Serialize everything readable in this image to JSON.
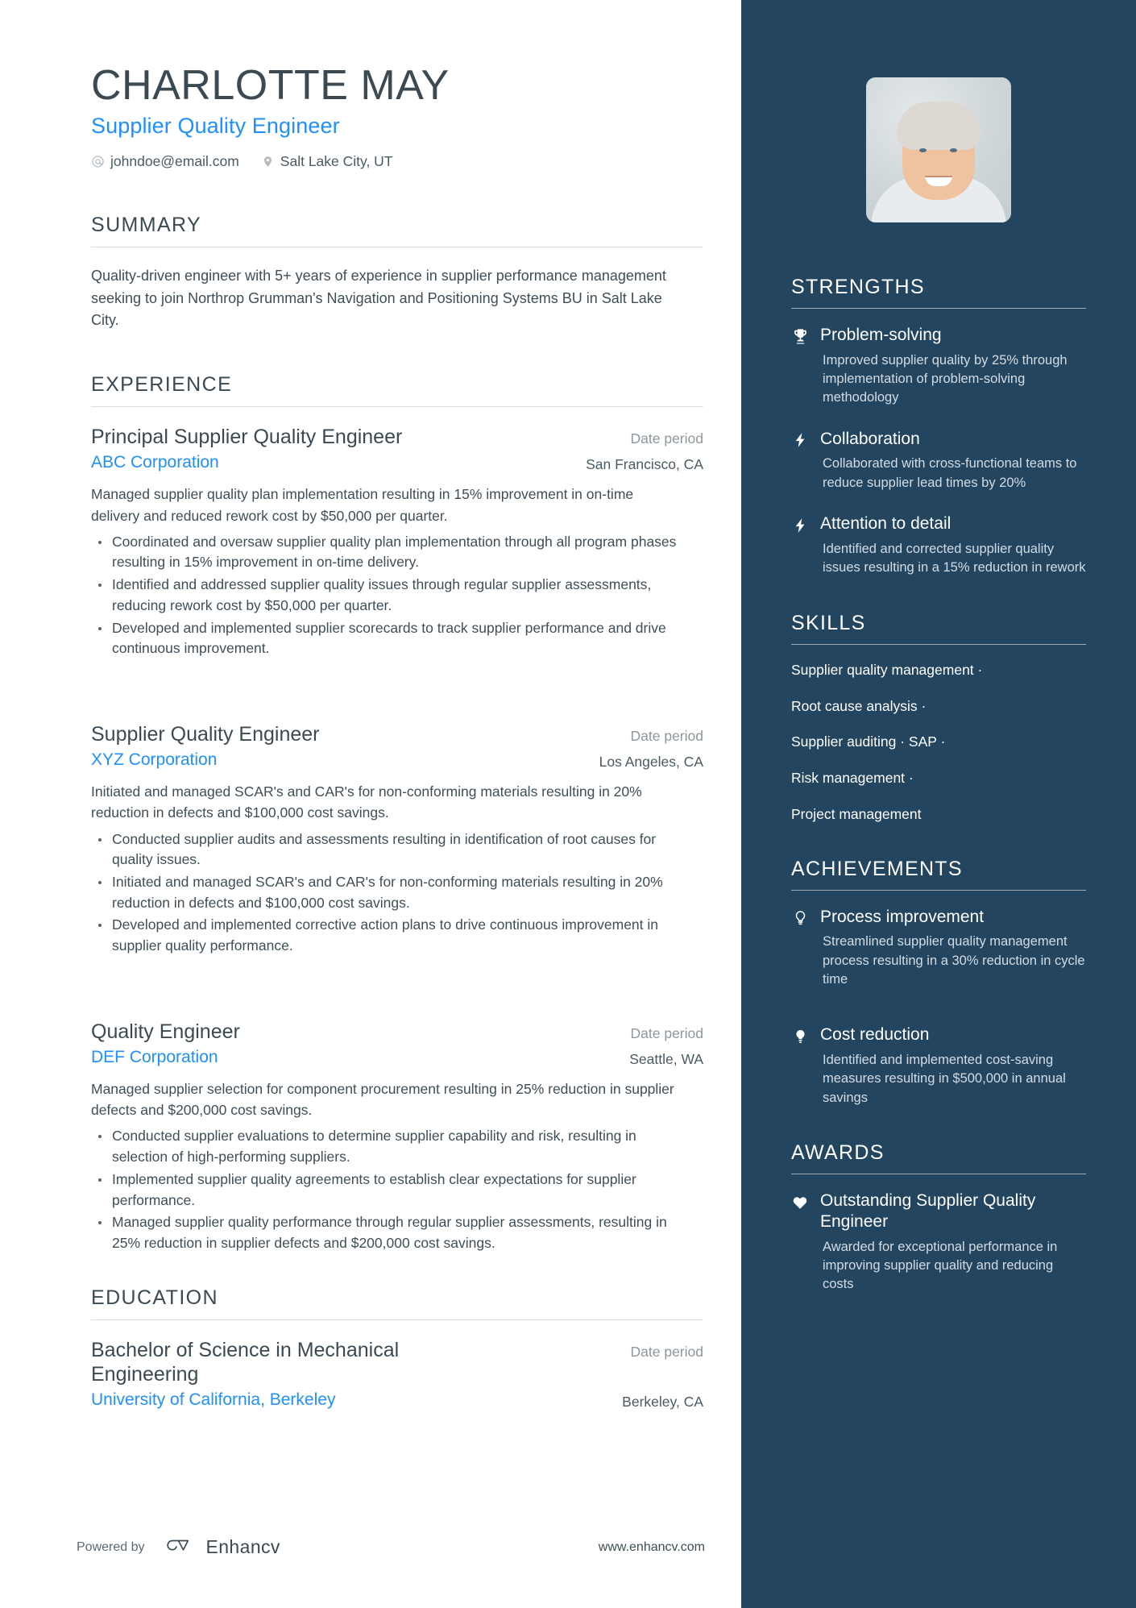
{
  "theme": {
    "sidebar_bg": "#23455f",
    "accent_blue": "#1e90ff",
    "heading_color": "#3b4a52",
    "body_color": "#3f4e57",
    "muted_color": "#8d979e"
  },
  "header": {
    "name": "CHARLOTTE MAY",
    "job_title": "Supplier Quality Engineer",
    "contacts": [
      {
        "icon": "at-icon",
        "text": "johndoe@email.com"
      },
      {
        "icon": "location-pin-icon",
        "text": "Salt Lake City, UT"
      }
    ]
  },
  "summary": {
    "heading": "SUMMARY",
    "text": "Quality-driven engineer with 5+ years of experience in supplier performance management seeking to join Northrop Grumman's Navigation and Positioning Systems BU in Salt Lake City."
  },
  "experience": {
    "heading": "EXPERIENCE",
    "entries": [
      {
        "role": "Principal Supplier Quality Engineer",
        "date": "Date period",
        "company": "ABC Corporation",
        "location": "San Francisco, CA",
        "description": "Managed supplier quality plan implementation resulting in 15% improvement in on-time delivery and reduced rework cost by $50,000 per quarter.",
        "bullets": [
          "Coordinated and oversaw supplier quality plan implementation through all program phases resulting in 15% improvement in on-time delivery.",
          "Identified and addressed supplier quality issues through regular supplier assessments, reducing rework cost by $50,000 per quarter.",
          "Developed and implemented supplier scorecards to track supplier performance and drive continuous improvement."
        ]
      },
      {
        "role": "Supplier Quality Engineer",
        "date": "Date period",
        "company": "XYZ Corporation",
        "location": "Los Angeles, CA",
        "description": "Initiated and managed SCAR's and CAR's for non-conforming materials resulting in 20% reduction in defects and $100,000 cost savings.",
        "bullets": [
          "Conducted supplier audits and assessments resulting in identification of root causes for quality issues.",
          "Initiated and managed SCAR's and CAR's for non-conforming materials resulting in 20% reduction in defects and $100,000 cost savings.",
          "Developed and implemented corrective action plans to drive continuous improvement in supplier quality performance."
        ]
      },
      {
        "role": "Quality Engineer",
        "date": "Date period",
        "company": "DEF Corporation",
        "location": "Seattle, WA",
        "description": "Managed supplier selection for component procurement resulting in 25% reduction in supplier defects and $200,000 cost savings.",
        "bullets": [
          "Conducted supplier evaluations to determine supplier capability and risk, resulting in selection of high-performing suppliers.",
          "Implemented supplier quality agreements to establish clear expectations for supplier performance.",
          "Managed supplier quality performance through regular supplier assessments, resulting in 25% reduction in supplier defects and $200,000 cost savings."
        ]
      }
    ]
  },
  "education": {
    "heading": "EDUCATION",
    "entries": [
      {
        "degree": "Bachelor of Science in Mechanical Engineering",
        "date": "Date period",
        "school": "University of California, Berkeley",
        "location": "Berkeley, CA"
      }
    ]
  },
  "footer": {
    "powered_by": "Powered by",
    "brand": "Enhancv",
    "brand_icon": "enhancv-logo-icon",
    "url": "www.enhancv.com"
  },
  "sidebar": {
    "photo": {
      "icon": "profile-photo",
      "alt": "Portrait photo of Charlotte May"
    },
    "strengths": {
      "heading": "STRENGTHS",
      "items": [
        {
          "icon": "trophy-icon",
          "title": "Problem-solving",
          "desc": "Improved supplier quality by 25% through implementation of problem-solving methodology"
        },
        {
          "icon": "lightning-bolt-icon",
          "title": "Collaboration",
          "desc": "Collaborated with cross-functional teams to reduce supplier lead times by 20%"
        },
        {
          "icon": "lightning-bolt-icon",
          "title": "Attention to detail",
          "desc": "Identified and corrected supplier quality issues resulting in a 15% reduction in rework"
        }
      ]
    },
    "skills": {
      "heading": "SKILLS",
      "items": [
        "Supplier quality management ·",
        "Root cause analysis ·",
        "Supplier auditing · SAP ·",
        "Risk management ·",
        "Project management"
      ]
    },
    "achievements": {
      "heading": "ACHIEVEMENTS",
      "items": [
        {
          "icon": "lightbulb-icon",
          "title": "Process improvement",
          "desc": "Streamlined supplier quality management process resulting in a 30% reduction in cycle time"
        },
        {
          "icon": "lightbulb-icon",
          "title": "Cost reduction",
          "desc": "Identified and implemented cost-saving measures resulting in $500,000 in annual savings"
        }
      ]
    },
    "awards": {
      "heading": "AWARDS",
      "items": [
        {
          "icon": "heart-icon",
          "title": "Outstanding Supplier Quality Engineer",
          "desc": "Awarded for exceptional performance in improving supplier quality and reducing costs"
        }
      ]
    }
  }
}
